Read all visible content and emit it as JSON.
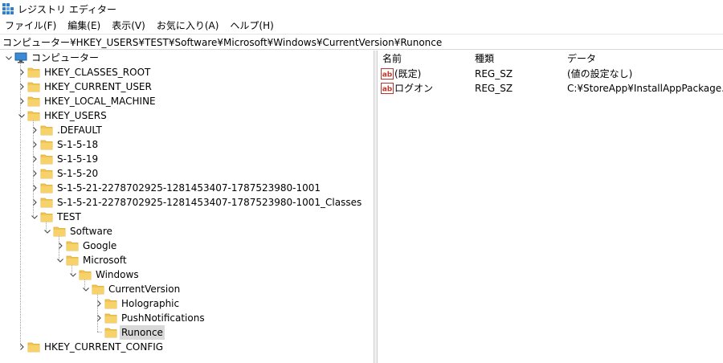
{
  "window": {
    "title": "レジストリ エディター",
    "icon": "registry-editor-icon"
  },
  "menu": [
    {
      "label": "ファイル(F)"
    },
    {
      "label": "編集(E)"
    },
    {
      "label": "表示(V)"
    },
    {
      "label": "お気に入り(A)"
    },
    {
      "label": "ヘルプ(H)"
    }
  ],
  "address": "コンピューター¥HKEY_USERS¥TEST¥Software¥Microsoft¥Windows¥CurrentVersion¥Runonce",
  "tree": {
    "root": "コンピューター",
    "hkey_classes_root": "HKEY_CLASSES_ROOT",
    "hkey_current_user": "HKEY_CURRENT_USER",
    "hkey_local_machine": "HKEY_LOCAL_MACHINE",
    "hkey_users": "HKEY_USERS",
    "default": ".DEFAULT",
    "s_1_5_18": "S-1-5-18",
    "s_1_5_19": "S-1-5-19",
    "s_1_5_20": "S-1-5-20",
    "s_user": "S-1-5-21-2278702925-1281453407-1787523980-1001",
    "s_user_classes": "S-1-5-21-2278702925-1281453407-1787523980-1001_Classes",
    "test": "TEST",
    "software": "Software",
    "google": "Google",
    "microsoft": "Microsoft",
    "windows": "Windows",
    "currentversion": "CurrentVersion",
    "holographic": "Holographic",
    "pushnotifications": "PushNotifications",
    "runonce": "Runonce",
    "hkey_current_config": "HKEY_CURRENT_CONFIG"
  },
  "list": {
    "headers": {
      "name": "名前",
      "type": "種類",
      "data": "データ"
    },
    "rows": [
      {
        "name": "(既定)",
        "type": "REG_SZ",
        "data": "(値の設定なし)",
        "icon": "string-value-icon"
      },
      {
        "name": "ログオン",
        "type": "REG_SZ",
        "data": "C:¥StoreApp¥InstallAppPackage.vbs",
        "icon": "string-value-icon"
      }
    ]
  },
  "colors": {
    "folder": "#f3c552",
    "folder_dark": "#dca92e",
    "selection": "#d9d9d9",
    "ab_icon": "#c0392b"
  }
}
